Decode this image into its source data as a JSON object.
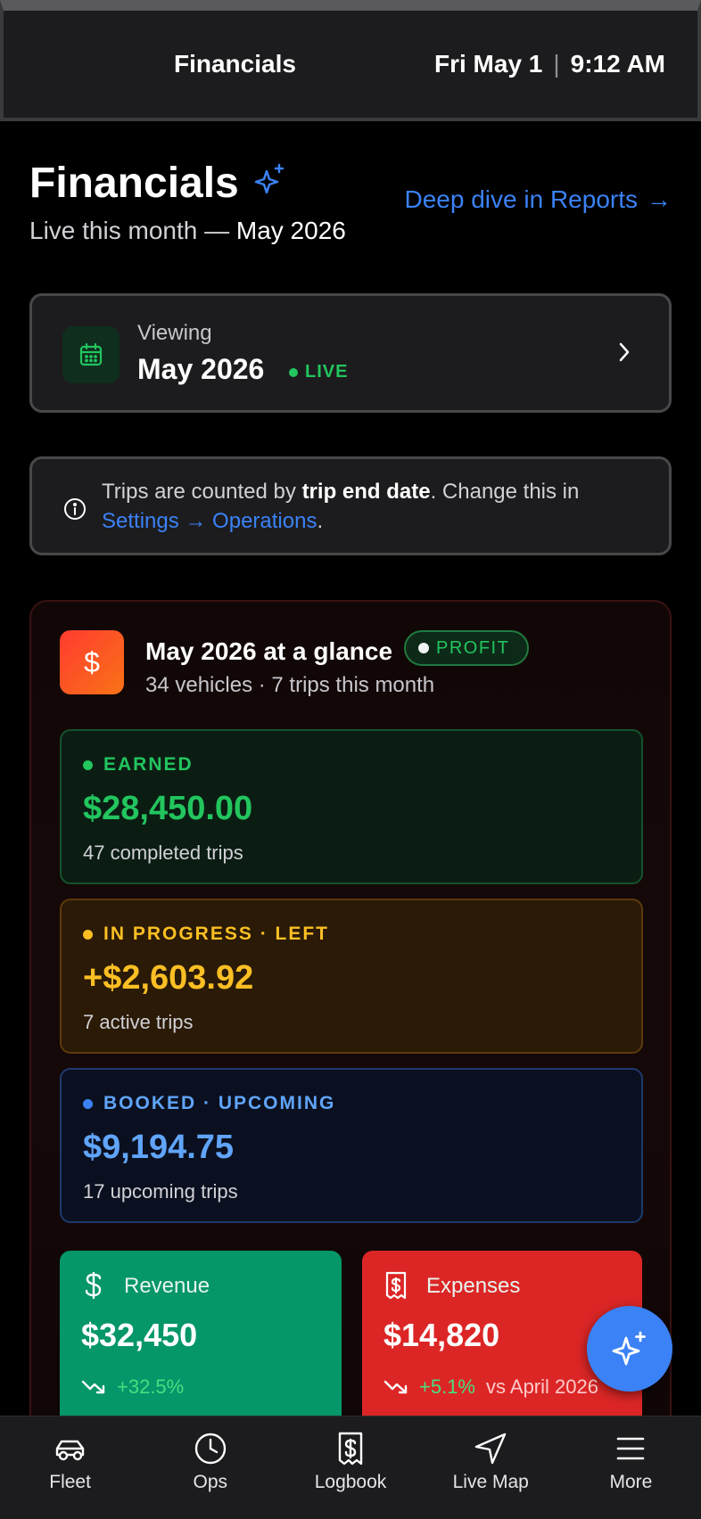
{
  "topbar": {
    "title": "Financials",
    "date": "Fri May 1",
    "separator": "|",
    "time": "9:12 AM"
  },
  "header": {
    "title": "Financials",
    "subtitle_prefix": "Live this month — ",
    "subtitle_month": "May 2026",
    "reports_link": "Deep dive in Reports",
    "reports_arrow": "→"
  },
  "viewing": {
    "label": "Viewing",
    "month": "May 2026",
    "live": "LIVE"
  },
  "info": {
    "text_before": "Trips are counted by ",
    "bold": "trip end date",
    "text_middle": ". Change this in ",
    "link": "Settings → Operations",
    "text_after": "."
  },
  "glance": {
    "icon": "$",
    "title": "May 2026 at a glance",
    "badge": "PROFIT",
    "subtitle": "34 vehicles · 7 trips this month",
    "earned": {
      "label": "EARNED",
      "amount": "$28,450.00",
      "note": "47 completed trips"
    },
    "in_progress": {
      "label": "IN PROGRESS · LEFT",
      "amount": "+$2,603.92",
      "note": "7 active trips"
    },
    "booked": {
      "label": "BOOKED · UPCOMING",
      "amount": "$9,194.75",
      "note": "17 upcoming trips"
    },
    "revenue": {
      "label": "Revenue",
      "amount": "$32,450",
      "change": "+32.5%"
    },
    "expenses": {
      "label": "Expenses",
      "amount": "$14,820",
      "change": "+5.1%",
      "compare": "vs April 2026"
    }
  },
  "nav": [
    {
      "label": "Fleet",
      "icon": "car-icon"
    },
    {
      "label": "Ops",
      "icon": "clock-icon"
    },
    {
      "label": "Logbook",
      "icon": "receipt-icon"
    },
    {
      "label": "Live Map",
      "icon": "navigation-icon"
    },
    {
      "label": "More",
      "icon": "menu-icon"
    }
  ],
  "colors": {
    "earned": "#22c55e",
    "in_progress": "#fbbf24",
    "booked": "#60a5fa",
    "accent": "#3b82f6",
    "revenue": "#059669",
    "expenses": "#dc2626"
  }
}
